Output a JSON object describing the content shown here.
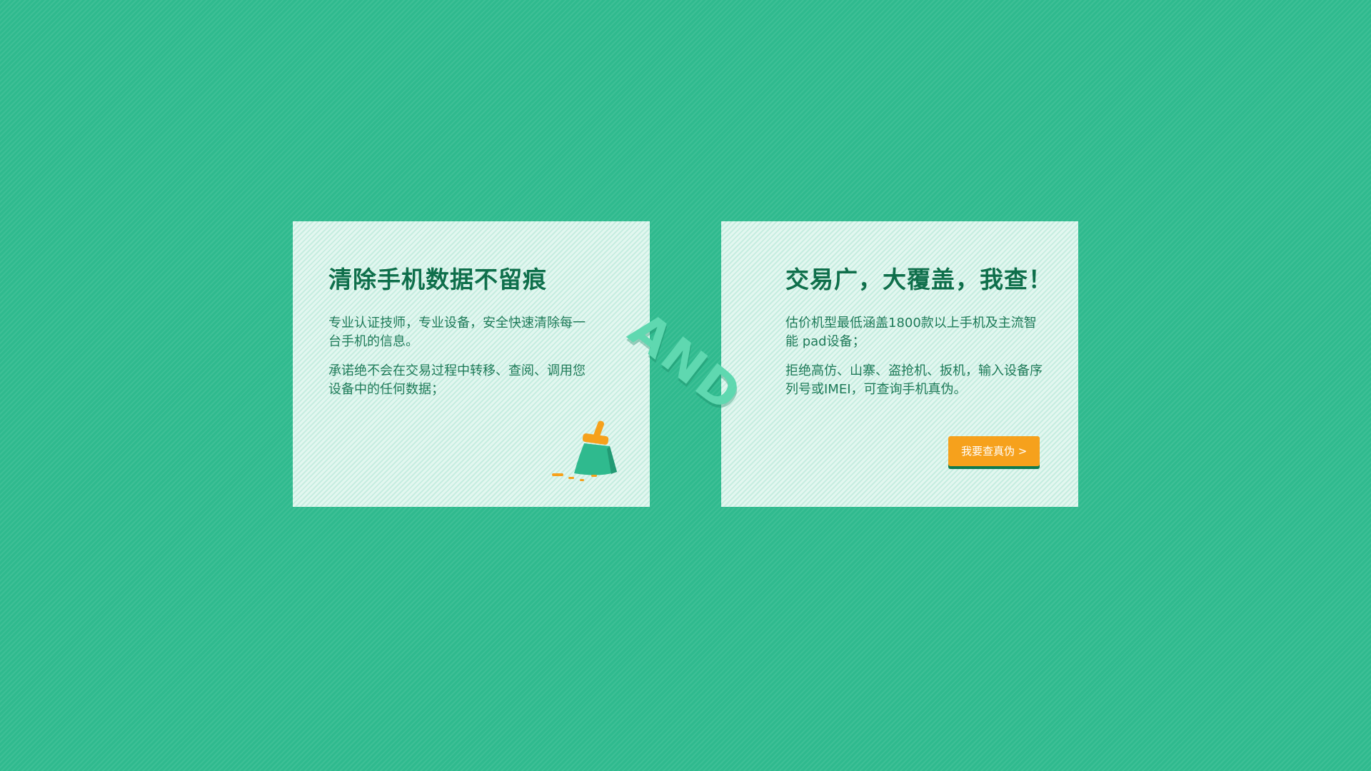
{
  "left_card": {
    "title": "清除手机数据不留痕",
    "paragraph_1": "专业认证技师，专业设备，安全快速清除每一台手机的信息。",
    "paragraph_2": "承诺绝不会在交易过程中转移、查阅、调用您设备中的任何数据；",
    "icon": "broom-icon"
  },
  "right_card": {
    "title": "交易广，大覆盖，我查！",
    "paragraph_1": "估价机型最低涵盖1800款以上手机及主流智能 pad设备；",
    "paragraph_2": "拒绝高仿、山寨、盗抢机、扳机，输入设备序列号或IMEI，可查询手机真伪。",
    "button_label": "我要查真伪 >"
  },
  "connector_text": "AND",
  "colors": {
    "background": "#2fba8e",
    "card": "#e3f7f0",
    "title": "#0f6f4b",
    "text": "#1e7a58",
    "button": "#f6a11c",
    "connector": "#5fd8b0"
  }
}
